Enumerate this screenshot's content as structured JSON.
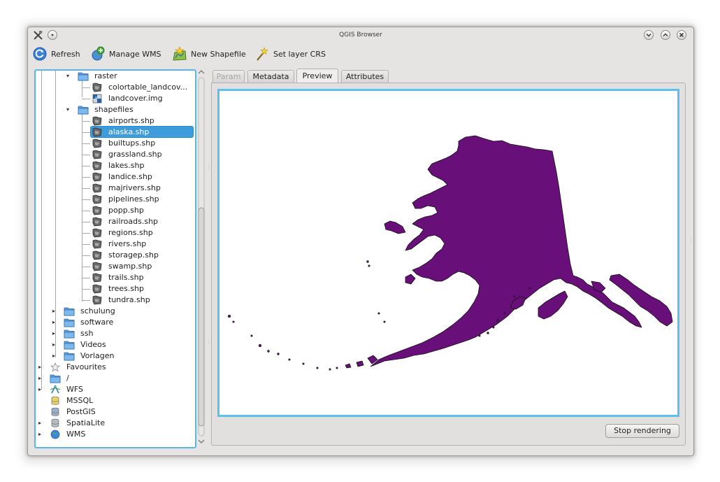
{
  "window": {
    "title": "QGIS Browser"
  },
  "toolbar": {
    "refresh": "Refresh",
    "manage_wms": "Manage WMS",
    "new_shapefile": "New Shapefile",
    "set_layer_crs": "Set layer CRS"
  },
  "tree": {
    "raster_folder": "raster",
    "raster_items": [
      "colortable_landcov...",
      "landcover.img"
    ],
    "shapefiles_folder": "shapefiles",
    "shapefiles": [
      "airports.shp",
      "alaska.shp",
      "builtups.shp",
      "grassland.shp",
      "lakes.shp",
      "landice.shp",
      "majrivers.shp",
      "pipelines.shp",
      "popp.shp",
      "railroads.shp",
      "regions.shp",
      "rivers.shp",
      "storagep.shp",
      "swamp.shp",
      "trails.shp",
      "trees.shp",
      "tundra.shp"
    ],
    "selected": "alaska.shp",
    "home_folders": [
      "schulung",
      "software",
      "ssh",
      "Videos",
      "Vorlagen"
    ],
    "roots": [
      "Favourites",
      "/",
      "WFS",
      "MSSQL",
      "PostGIS",
      "SpatiaLite",
      "WMS"
    ]
  },
  "tabs": [
    "Param",
    "Metadata",
    "Preview",
    "Attributes"
  ],
  "active_tab": "Preview",
  "preview": {
    "layer_fill_color": "#680f7a",
    "stop_button": "Stop rendering"
  },
  "colors": {
    "selection": "#3d9ddc",
    "focus_border": "#5bc0f0"
  }
}
